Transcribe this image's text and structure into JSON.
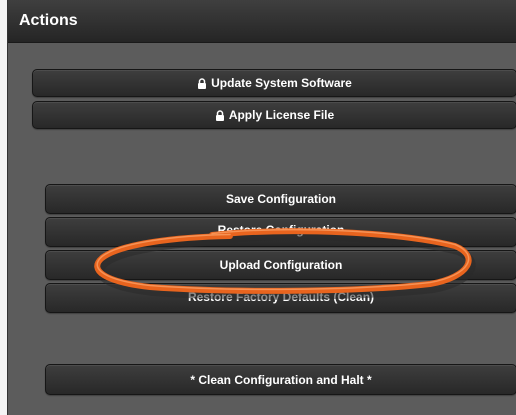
{
  "panel": {
    "title": "Actions"
  },
  "buttons": {
    "update_software": "Update System Software",
    "apply_license": "Apply License File",
    "save_config": "Save Configuration",
    "restore_config": "Restore Configuration",
    "upload_config": "Upload Configuration",
    "restore_factory": "Restore Factory Defaults (Clean)",
    "clean_halt": "* Clean Configuration and Halt *"
  },
  "annotation": {
    "color": "#e8641e"
  }
}
